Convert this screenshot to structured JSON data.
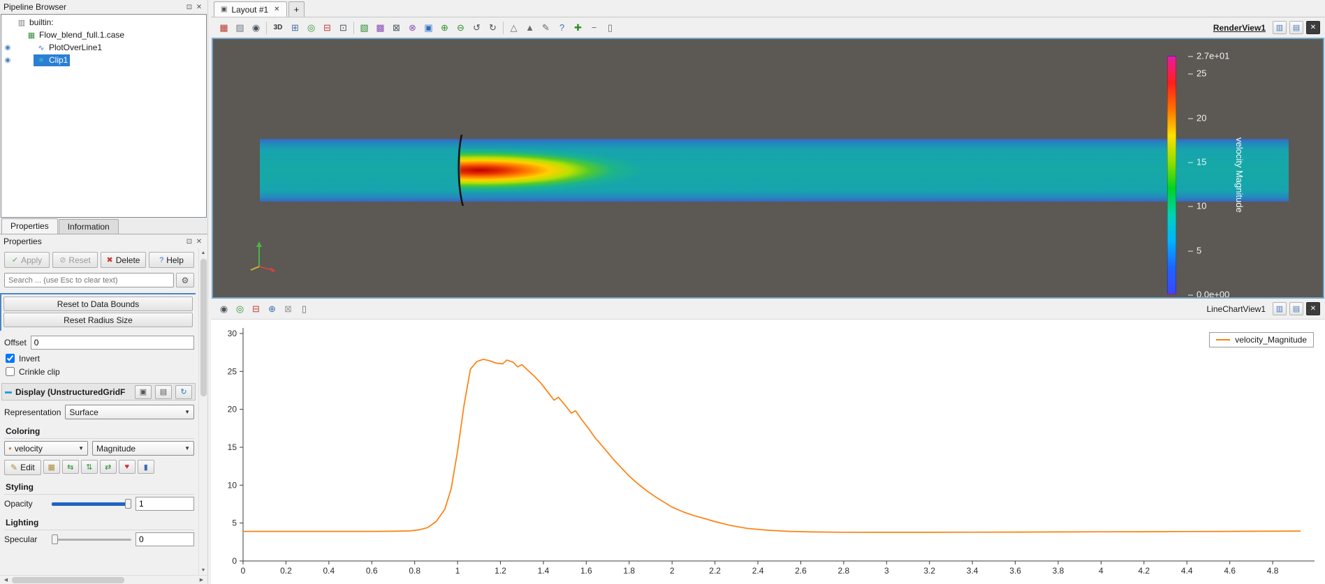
{
  "pipeline_browser": {
    "title": "Pipeline Browser",
    "items": [
      {
        "label": "builtin:",
        "icon": "server-icon",
        "glyph": "▥",
        "color": "#7a7a7a",
        "depth": 0,
        "visible": false,
        "selected": false
      },
      {
        "label": "Flow_blend_full.1.case",
        "icon": "case-icon",
        "glyph": "▦",
        "color": "#3a8f3a",
        "depth": 1,
        "visible": false,
        "selected": false
      },
      {
        "label": "PlotOverLine1",
        "icon": "plot-over-line-icon",
        "glyph": "∿",
        "color": "#3b6fd4",
        "depth": 2,
        "visible": true,
        "selected": false
      },
      {
        "label": "Clip1",
        "icon": "clip-icon",
        "glyph": "■",
        "color": "#2faac8",
        "depth": 2,
        "visible": true,
        "selected": true
      }
    ]
  },
  "tabs": {
    "properties": "Properties",
    "information": "Information"
  },
  "properties_panel": {
    "title": "Properties",
    "apply_label": "Apply",
    "reset_label": "Reset",
    "delete_label": "Delete",
    "help_label": "Help",
    "search_placeholder": "Search ... (use Esc to clear text)",
    "reset_data_bounds_label": "Reset to Data Bounds",
    "reset_radius_size_label": "Reset Radius Size",
    "offset_label": "Offset",
    "offset_value": "0",
    "invert_label": "Invert",
    "invert_checked": true,
    "crinkle_label": "Crinkle clip",
    "crinkle_checked": false,
    "display_header": "Display (UnstructuredGridF",
    "representation_label": "Representation",
    "representation_value": "Surface",
    "coloring_label": "Coloring",
    "color_array_value": "velocity",
    "color_component_value": "Magnitude",
    "edit_label": "Edit",
    "styling_label": "Styling",
    "opacity_label": "Opacity",
    "opacity_value": "1",
    "lighting_label": "Lighting",
    "specular_label": "Specular",
    "specular_value": "0"
  },
  "layout": {
    "tab_label": "Layout #1",
    "add_tab": "+"
  },
  "render_view": {
    "name": "RenderView1",
    "toolbar": [
      {
        "name": "show-color-legend-icon",
        "glyph": "▦",
        "color": "#b5372a"
      },
      {
        "name": "edit-color-map-icon",
        "glyph": "▨",
        "color": "#737d84"
      },
      {
        "name": "save-screenshot-icon",
        "glyph": "◉",
        "color": "#4a545c"
      },
      {
        "sep": true
      },
      {
        "name": "toggle-2d3d-button",
        "glyph": "3D",
        "color": "#333333",
        "text": true
      },
      {
        "name": "zoom-to-box-icon",
        "glyph": "⊞",
        "color": "#4a6fa5"
      },
      {
        "name": "reset-camera-icon",
        "glyph": "◎",
        "color": "#2f8f2f"
      },
      {
        "name": "zoom-out-icon",
        "glyph": "⊟",
        "color": "#c23b2e"
      },
      {
        "name": "rubber-band-zoom-icon",
        "glyph": "⊡",
        "color": "#4a545c"
      },
      {
        "sep": true
      },
      {
        "name": "select-cells-on-icon",
        "glyph": "▧",
        "color": "#2f8f2f"
      },
      {
        "name": "select-points-on-icon",
        "glyph": "▩",
        "color": "#8a4fb0"
      },
      {
        "name": "select-frustum-cells-icon",
        "glyph": "⊠",
        "color": "#4a545c"
      },
      {
        "name": "select-frustum-points-icon",
        "glyph": "⊗",
        "color": "#8a4fb0"
      },
      {
        "name": "select-block-icon",
        "glyph": "▣",
        "color": "#2e6fc2"
      },
      {
        "name": "interactive-select-cells-icon",
        "glyph": "⊕",
        "color": "#2f8f2f"
      },
      {
        "name": "interactive-select-points-icon",
        "glyph": "⊖",
        "color": "#2f8f2f"
      },
      {
        "name": "hover-cells-icon",
        "glyph": "↺",
        "color": "#4a545c"
      },
      {
        "name": "hover-points-icon",
        "glyph": "↻",
        "color": "#4a545c"
      },
      {
        "sep": true
      },
      {
        "name": "ruler-icon",
        "glyph": "△",
        "color": "#6b6b6b"
      },
      {
        "name": "probe-location-icon",
        "glyph": "▲",
        "color": "#6b6b6b"
      },
      {
        "name": "annotation-icon",
        "glyph": "✎",
        "color": "#6b6b6b"
      },
      {
        "name": "whats-this-icon",
        "glyph": "?",
        "color": "#3a6fb0"
      },
      {
        "name": "add-selection-icon",
        "glyph": "✚",
        "color": "#2f8f2f"
      },
      {
        "name": "subtract-selection-icon",
        "glyph": "−",
        "color": "#6b6b6b"
      },
      {
        "name": "delete-selection-icon",
        "glyph": "▯",
        "color": "#6b6b6b"
      }
    ],
    "colorbar": {
      "title": "velocity Magnitude",
      "max_label": "2.7e+01",
      "min_label": "0.0e+00",
      "max_value": 27,
      "min_value": 0,
      "ticks": [
        {
          "value": 25,
          "label": "25"
        },
        {
          "value": 20,
          "label": "20"
        },
        {
          "value": 15,
          "label": "15"
        },
        {
          "value": 10,
          "label": "10"
        },
        {
          "value": 5,
          "label": "5"
        }
      ],
      "colors": [
        "#e81ca0",
        "#ff1e1e",
        "#ff7300",
        "#ffe100",
        "#8fe000",
        "#00d226",
        "#00d2b4",
        "#00b4ff",
        "#1e64ff",
        "#3c46ff"
      ]
    }
  },
  "chart_view": {
    "name": "LineChartView1",
    "legend": "velocity_Magnitude",
    "toolbar": [
      {
        "name": "save-screenshot-icon",
        "glyph": "◉",
        "color": "#4a545c"
      },
      {
        "name": "reset-view-icon",
        "glyph": "◎",
        "color": "#2f8f2f"
      },
      {
        "name": "zoom-out-icon",
        "glyph": "⊟",
        "color": "#c23b2e"
      },
      {
        "name": "zoom-to-box-icon",
        "glyph": "⊕",
        "color": "#3a6fb0"
      },
      {
        "name": "select-chart-region-icon",
        "glyph": "⊠",
        "color": "#9a9a9a"
      },
      {
        "name": "delete-selection-icon",
        "glyph": "▯",
        "color": "#6b6b6b"
      }
    ]
  },
  "chart_data": {
    "type": "line",
    "title": "",
    "xlabel": "",
    "ylabel": "",
    "xlim": [
      0,
      4.93
    ],
    "ylim": [
      0,
      30
    ],
    "grid": false,
    "legend_position": "top-right",
    "x_ticks": [
      0,
      0.2,
      0.4,
      0.6,
      0.8,
      1,
      1.2,
      1.4,
      1.6,
      1.8,
      2,
      2.2,
      2.4,
      2.6,
      2.8,
      3,
      3.2,
      3.4,
      3.6,
      3.8,
      4,
      4.2,
      4.4,
      4.6,
      4.8
    ],
    "y_ticks": [
      0,
      5,
      10,
      15,
      20,
      25,
      30
    ],
    "series": [
      {
        "name": "velocity_Magnitude",
        "color": "#ff7f0e",
        "points": [
          [
            0,
            3.9
          ],
          [
            0.15,
            3.9
          ],
          [
            0.3,
            3.9
          ],
          [
            0.45,
            3.9
          ],
          [
            0.6,
            3.9
          ],
          [
            0.7,
            3.92
          ],
          [
            0.78,
            3.97
          ],
          [
            0.82,
            4.1
          ],
          [
            0.86,
            4.4
          ],
          [
            0.9,
            5.2
          ],
          [
            0.94,
            6.8
          ],
          [
            0.97,
            9.5
          ],
          [
            1.0,
            14.5
          ],
          [
            1.03,
            20.5
          ],
          [
            1.06,
            25.3
          ],
          [
            1.09,
            26.3
          ],
          [
            1.12,
            26.6
          ],
          [
            1.15,
            26.4
          ],
          [
            1.18,
            26.1
          ],
          [
            1.21,
            26.0
          ],
          [
            1.23,
            26.5
          ],
          [
            1.26,
            26.2
          ],
          [
            1.28,
            25.6
          ],
          [
            1.3,
            25.9
          ],
          [
            1.33,
            25.1
          ],
          [
            1.36,
            24.3
          ],
          [
            1.39,
            23.4
          ],
          [
            1.42,
            22.3
          ],
          [
            1.45,
            21.2
          ],
          [
            1.47,
            21.6
          ],
          [
            1.5,
            20.6
          ],
          [
            1.53,
            19.5
          ],
          [
            1.55,
            19.8
          ],
          [
            1.58,
            18.6
          ],
          [
            1.61,
            17.5
          ],
          [
            1.64,
            16.3
          ],
          [
            1.67,
            15.3
          ],
          [
            1.7,
            14.3
          ],
          [
            1.73,
            13.3
          ],
          [
            1.76,
            12.4
          ],
          [
            1.8,
            11.2
          ],
          [
            1.84,
            10.2
          ],
          [
            1.88,
            9.3
          ],
          [
            1.92,
            8.5
          ],
          [
            1.96,
            7.8
          ],
          [
            2.0,
            7.1
          ],
          [
            2.05,
            6.5
          ],
          [
            2.1,
            6.0
          ],
          [
            2.15,
            5.6
          ],
          [
            2.2,
            5.2
          ],
          [
            2.27,
            4.7
          ],
          [
            2.35,
            4.3
          ],
          [
            2.45,
            4.05
          ],
          [
            2.55,
            3.9
          ],
          [
            2.65,
            3.83
          ],
          [
            2.8,
            3.79
          ],
          [
            3.0,
            3.78
          ],
          [
            3.2,
            3.78
          ],
          [
            3.4,
            3.8
          ],
          [
            3.6,
            3.81
          ],
          [
            3.8,
            3.83
          ],
          [
            4.0,
            3.85
          ],
          [
            4.2,
            3.86
          ],
          [
            4.4,
            3.88
          ],
          [
            4.6,
            3.9
          ],
          [
            4.75,
            3.92
          ],
          [
            4.93,
            3.95
          ]
        ]
      }
    ]
  },
  "dock_icons": {
    "float": "⊡",
    "close": "✕"
  }
}
